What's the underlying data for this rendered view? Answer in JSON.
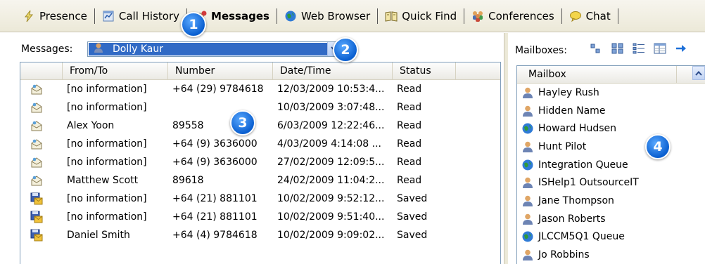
{
  "tabs": [
    {
      "label": "Presence",
      "icon": "presence-icon"
    },
    {
      "label": "Call History",
      "icon": "call-history-icon"
    },
    {
      "label": "Messages",
      "icon": "messages-icon",
      "active": true
    },
    {
      "label": "Web Browser",
      "icon": "globe-icon"
    },
    {
      "label": "Quick Find",
      "icon": "book-icon"
    },
    {
      "label": "Conferences",
      "icon": "conferences-icon"
    },
    {
      "label": "Chat",
      "icon": "chat-bubble-icon"
    }
  ],
  "messages_panel": {
    "label": "Messages:",
    "selected_mailbox": "Dolly Kaur"
  },
  "table": {
    "columns": [
      "",
      "From/To",
      "Number",
      "Date/Time",
      "Status"
    ],
    "rows": [
      {
        "icon": "read-message-icon",
        "from_to": "[no information]",
        "number": "+64 (29) 9784618",
        "datetime": "12/03/2009 10:53:4...",
        "status": "Read"
      },
      {
        "icon": "read-message-icon",
        "from_to": "[no information]",
        "number": "",
        "datetime": "10/03/2009 3:07:48...",
        "status": "Read"
      },
      {
        "icon": "read-message-icon",
        "from_to": "Alex Yoon",
        "number": "89558",
        "datetime": "6/03/2009 12:22:46...",
        "status": "Read"
      },
      {
        "icon": "read-message-icon",
        "from_to": "[no information]",
        "number": "+64 (9) 3636000",
        "datetime": "4/03/2009 4:14:08 ...",
        "status": "Read"
      },
      {
        "icon": "read-message-icon",
        "from_to": "[no information]",
        "number": "+64 (9) 3636000",
        "datetime": "27/02/2009 12:09:5...",
        "status": "Read"
      },
      {
        "icon": "read-message-icon",
        "from_to": "Matthew Scott",
        "number": "89618",
        "datetime": "24/02/2009 11:04:2...",
        "status": "Read"
      },
      {
        "icon": "saved-message-icon",
        "from_to": "[no information]",
        "number": "+64 (21) 881101",
        "datetime": "10/02/2009 9:52:12...",
        "status": "Saved"
      },
      {
        "icon": "saved-message-icon",
        "from_to": "[no information]",
        "number": "+64 (21) 881101",
        "datetime": "10/02/2009 9:51:40...",
        "status": "Saved"
      },
      {
        "icon": "saved-message-icon",
        "from_to": "Daniel Smith",
        "number": "+64 (4) 9784618",
        "datetime": "10/02/2009 9:09:02...",
        "status": "Saved"
      }
    ]
  },
  "mailboxes_panel": {
    "label": "Mailboxes:",
    "column": "Mailbox",
    "items": [
      {
        "name": "Hayley Rush",
        "icon": "person-icon"
      },
      {
        "name": "Hidden Name",
        "icon": "person-icon"
      },
      {
        "name": "Howard Hudsen",
        "icon": "globe-icon"
      },
      {
        "name": "Hunt Pilot",
        "icon": "person-icon"
      },
      {
        "name": "Integration Queue",
        "icon": "globe-icon"
      },
      {
        "name": "ISHelp1 OutsourceIT",
        "icon": "person-icon"
      },
      {
        "name": "Jane Thompson",
        "icon": "person-icon"
      },
      {
        "name": "Jason Roberts",
        "icon": "person-icon"
      },
      {
        "name": "JLCCM5Q1 Queue",
        "icon": "globe-icon"
      },
      {
        "name": "Jo Robbins",
        "icon": "person-icon"
      }
    ]
  },
  "callouts": [
    "1",
    "2",
    "3",
    "4"
  ],
  "colors": {
    "selection": "#316ac5",
    "callout": "#0a5fd0",
    "border": "#7f9db9",
    "toolbar_bg": "#ece9d8"
  }
}
